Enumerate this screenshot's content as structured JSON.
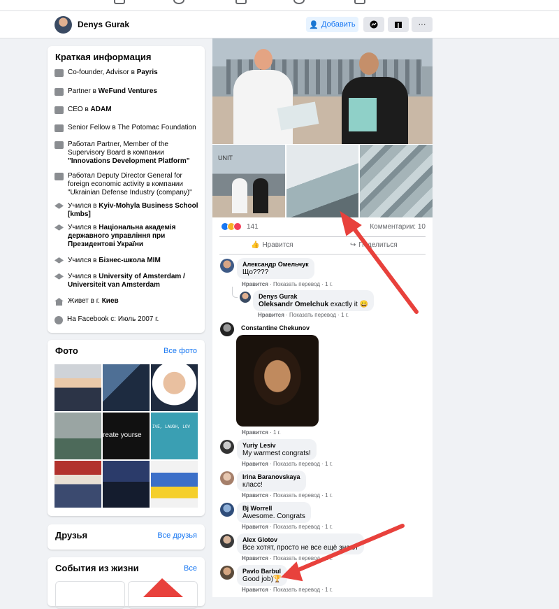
{
  "profile_bar": {
    "name": "Denys Gurak",
    "add_label": "Добавить",
    "more_label": "···"
  },
  "intro": {
    "title": "Краткая информация",
    "items": [
      {
        "icon": "briefcase-icon",
        "text": "Co-founder, Advisor в",
        "strong": "Payris"
      },
      {
        "icon": "briefcase-icon",
        "text": "Partner в",
        "strong": "WeFund Ventures"
      },
      {
        "icon": "briefcase-icon",
        "text": "CEO в",
        "strong": "ADAM"
      },
      {
        "icon": "briefcase-icon",
        "text": "Senior Fellow в The Potomac Foundation",
        "strong": ""
      },
      {
        "icon": "briefcase-icon",
        "text": "Работал Partner, Member of the Supervisory Board в компании",
        "strong": "\"Innovations Development Platform\""
      },
      {
        "icon": "briefcase-icon",
        "text": "Работал Deputy Director General for foreign economic activity в компании \"Ukrainian Defense Industry (company)\"",
        "strong": ""
      },
      {
        "icon": "graduation-cap-icon",
        "text": "Учился в",
        "strong": "Kyiv-Mohyla Business School [kmbs]"
      },
      {
        "icon": "graduation-cap-icon",
        "text": "Учился в",
        "strong": "Національна академія державного управління при Президентові України"
      },
      {
        "icon": "graduation-cap-icon",
        "text": "Учился в",
        "strong": "Бізнес-школа MIM"
      },
      {
        "icon": "graduation-cap-icon",
        "text": "Учился в",
        "strong": "University of Amsterdam / Universiteit van Amsterdam"
      },
      {
        "icon": "home-icon",
        "text": "Живет в г.",
        "strong": "Киев"
      },
      {
        "icon": "clock-icon",
        "text": "На Facebook с: Июль 2007 г.",
        "strong": ""
      }
    ]
  },
  "photos": {
    "title": "Фото",
    "all_link": "Все фото",
    "tile_text": [
      "reate yourse",
      "IVE, LAUGH, LOV"
    ]
  },
  "friends": {
    "title": "Друзья",
    "all_link": "Все друзья"
  },
  "life_events": {
    "title": "События из жизни",
    "all_link": "Все"
  },
  "post": {
    "photo_text": "UNIT",
    "reaction_count": "141",
    "comments_count": "Комментарии: 10",
    "like_label": "Нравится",
    "share_label": "Поделиться"
  },
  "comments": [
    {
      "author": "Александр Омельчук",
      "text": "Що????",
      "meta_like": "Нравится",
      "meta_rest": "· Показать перевод · 1 г."
    },
    {
      "author": "Denys Gurak",
      "mention": "Oleksandr Omelchuk",
      "text": "exactly it 😀",
      "meta_like": "Нравится",
      "meta_rest": "· Показать перевод · 1 г."
    },
    {
      "author": "Constantine Chekunov",
      "text": "",
      "meta_like": "Нравится",
      "meta_rest": "· 1 г."
    },
    {
      "author": "Yuriy Lesiv",
      "text": "My warmest congrats!",
      "meta_like": "Нравится",
      "meta_rest": "· Показать перевод · 1 г."
    },
    {
      "author": "Irina Baranovskaya",
      "text": "класс!",
      "meta_like": "Нравится",
      "meta_rest": "· Показать перевод · 1 г."
    },
    {
      "author": "Bj Worrell",
      "text": "Awesome. Congrats",
      "meta_like": "Нравится",
      "meta_rest": "· Показать перевод · 1 г."
    },
    {
      "author": "Alex Glotov",
      "text": "Все хотят, просто не все ещё знают",
      "meta_like": "Нравится",
      "meta_rest": "· Показать перевод · 1 г."
    },
    {
      "author": "Pavlo Barbul",
      "text": "Good job)🏆",
      "meta_like": "Нравится",
      "meta_rest": "· Показать перевод · 1 г."
    }
  ],
  "colors": {
    "accent": "#1877f2",
    "arrow": "#e8413c"
  }
}
